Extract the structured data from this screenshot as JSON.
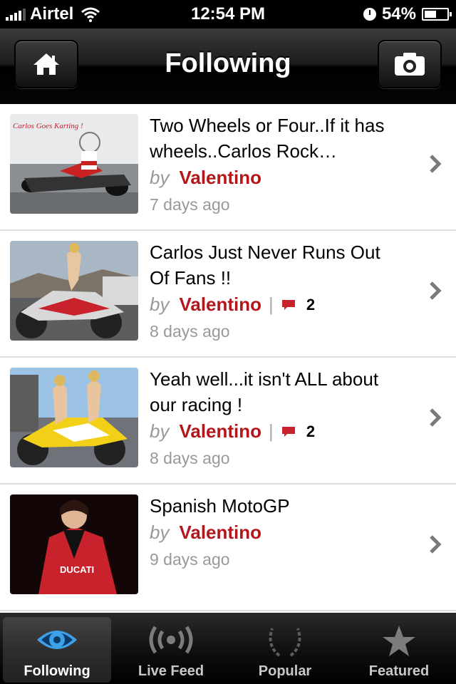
{
  "status": {
    "carrier": "Airtel",
    "time": "12:54 PM",
    "battery": "54%",
    "battery_level": 0.54
  },
  "nav": {
    "title": "Following",
    "left_icon": "home-icon",
    "right_icon": "camera-icon"
  },
  "posts": [
    {
      "title": "Two Wheels or Four..If it has wheels..Carlos Rock…",
      "by": "by",
      "author": "Valentino",
      "comments": "",
      "ago": "7 days ago",
      "thumb_text": "Carlos Goes Karting !"
    },
    {
      "title": "Carlos Just Never Runs Out Of Fans !!",
      "by": "by",
      "author": "Valentino",
      "comments": "2",
      "ago": "8 days ago"
    },
    {
      "title": "Yeah well...it isn't ALL about our racing !",
      "by": "by",
      "author": "Valentino",
      "comments": "2",
      "ago": "8 days ago"
    },
    {
      "title": "Spanish MotoGP",
      "by": "by",
      "author": "Valentino",
      "comments": "",
      "ago": "9 days ago",
      "thumb_text": "DUCATI"
    }
  ],
  "tabs": [
    {
      "label": "Following",
      "icon": "eye-icon",
      "active": true
    },
    {
      "label": "Live Feed",
      "icon": "broadcast-icon",
      "active": false
    },
    {
      "label": "Popular",
      "icon": "laurel-icon",
      "active": false
    },
    {
      "label": "Featured",
      "icon": "star-icon",
      "active": false
    }
  ],
  "colors": {
    "author": "#b4171b",
    "active_tab_icon": "#3ea0e6"
  }
}
